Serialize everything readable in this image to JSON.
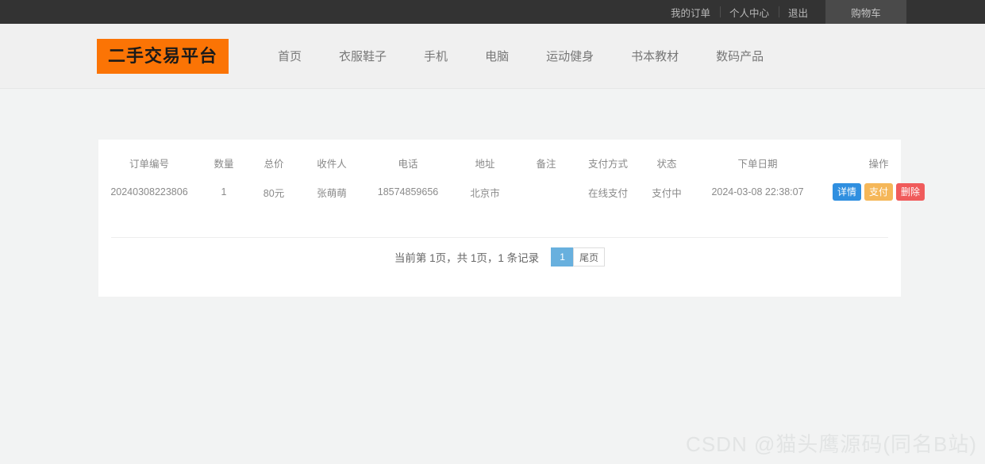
{
  "topbar": {
    "links": [
      {
        "label": "我的订单",
        "name": "topbar-link-my-orders"
      },
      {
        "label": "个人中心",
        "name": "topbar-link-profile"
      },
      {
        "label": "退出",
        "name": "topbar-link-logout"
      }
    ],
    "cart_label": "购物车"
  },
  "header": {
    "logo": "二手交易平台",
    "nav": [
      {
        "label": "首页"
      },
      {
        "label": "衣服鞋子"
      },
      {
        "label": "手机"
      },
      {
        "label": "电脑"
      },
      {
        "label": "运动健身"
      },
      {
        "label": "书本教材"
      },
      {
        "label": "数码产品"
      }
    ]
  },
  "table": {
    "columns": [
      "订单编号",
      "数量",
      "总价",
      "收件人",
      "电话",
      "地址",
      "备注",
      "支付方式",
      "状态",
      "下单日期",
      "操作"
    ],
    "rows": [
      {
        "order_no": "20240308223806",
        "quantity": "1",
        "total": "80元",
        "receiver": "张萌萌",
        "phone": "18574859656",
        "address": "北京市",
        "remark": "",
        "pay_method": "在线支付",
        "status": "支付中",
        "order_date": "2024-03-08 22:38:07",
        "actions": {
          "detail": "详情",
          "pay": "支付",
          "delete": "删除"
        }
      }
    ]
  },
  "pagination": {
    "summary": "当前第 1页，共 1页，1 条记录",
    "current_page": "1",
    "last_page_label": "尾页"
  },
  "watermark": "CSDN @猫头鹰源码(同名B站)",
  "colors": {
    "brand_orange": "#fb7405",
    "topbar_dark": "#333333",
    "detail_blue": "#2f8fe0",
    "pay_amber": "#f5b759",
    "delete_red": "#f05b5b",
    "pager_active_blue": "#68b0de",
    "page_bg": "#f2f3f3"
  }
}
